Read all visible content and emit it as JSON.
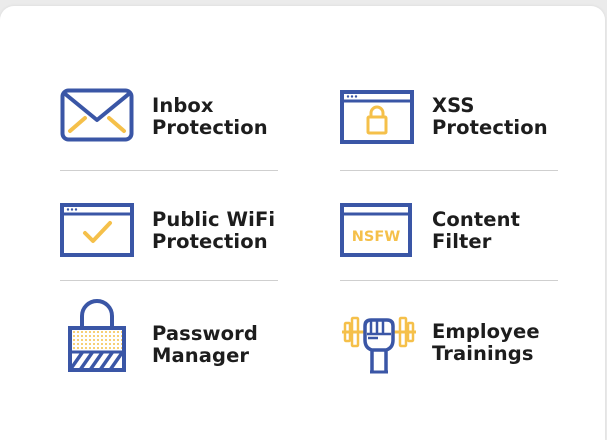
{
  "colors": {
    "blue": "#3a56a6",
    "yellow": "#f5c04a",
    "text": "#1d1d1d",
    "divider": "#cfcfcf"
  },
  "features": [
    {
      "name": "inbox-protection",
      "icon": "envelope-icon",
      "line1": "Inbox",
      "line2": "Protection"
    },
    {
      "name": "xss-protection",
      "icon": "browser-lock-icon",
      "line1": "XSS",
      "line2": "Protection"
    },
    {
      "name": "public-wifi-protection",
      "icon": "browser-check-icon",
      "line1": "Public WiFi",
      "line2": "Protection"
    },
    {
      "name": "content-filter",
      "icon": "nsfw-browser-icon",
      "line1": "Content",
      "line2": "Filter",
      "icon_text": "NSFW"
    },
    {
      "name": "password-manager",
      "icon": "padlock-icon",
      "line1": "Password",
      "line2": "Manager"
    },
    {
      "name": "employee-trainings",
      "icon": "fist-dumbbell-icon",
      "line1": "Employee",
      "line2": "Trainings"
    }
  ]
}
